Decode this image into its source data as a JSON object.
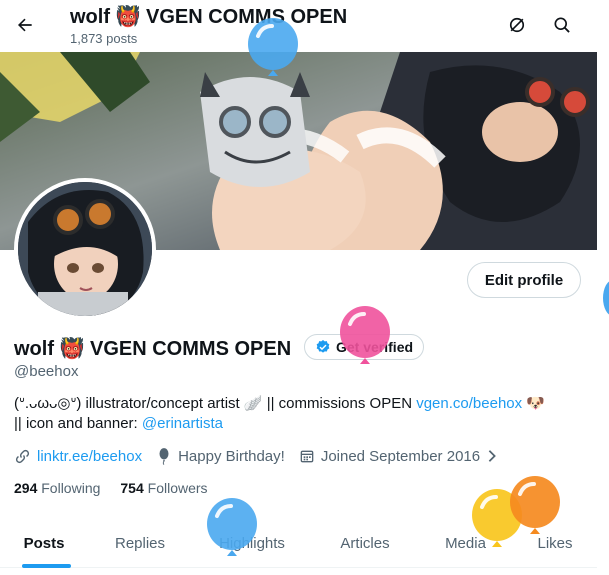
{
  "header": {
    "display_name": "wolf 👹 VGEN COMMS OPEN",
    "post_count": "1,873 posts"
  },
  "profile": {
    "display_name": "wolf 👹 VGEN COMMS OPEN",
    "handle": "@beehox",
    "edit_label": "Edit profile",
    "verify_label": "Get verified",
    "bio_text_1": "(ᐡ.ᴗωᴗ◎ᐡ) illustrator/concept artist 🪽 || commissions OPEN ",
    "bio_link_1": "vgen.co/beehox",
    "bio_emoji": " 🐶",
    "bio_text_2": "|| icon and banner: ",
    "bio_link_2": "@erinartista",
    "website": "linktr.ee/beehox",
    "birthday": "Happy Birthday!",
    "joined": "Joined September 2016",
    "following_count": "294",
    "following_label": "Following",
    "followers_count": "754",
    "followers_label": "Followers"
  },
  "tabs": [
    {
      "label": "Posts",
      "active": true
    },
    {
      "label": "Replies",
      "active": false
    },
    {
      "label": "Highlights",
      "active": false
    },
    {
      "label": "Articles",
      "active": false
    },
    {
      "label": "Media",
      "active": false
    },
    {
      "label": "Likes",
      "active": false
    }
  ],
  "colors": {
    "accent": "#1d9bf0",
    "secondary_text": "#536471",
    "balloon_blue": "#4aa8ef",
    "balloon_pink": "#f0529c",
    "balloon_yellow": "#f9c51d",
    "balloon_orange": "#f58a1f"
  },
  "icons": {
    "back": "arrow-left-icon",
    "no_circle": "slashed-circle-icon",
    "search": "search-icon",
    "verified": "verified-badge-icon",
    "link": "link-icon",
    "balloon": "balloon-icon",
    "calendar": "calendar-icon"
  }
}
